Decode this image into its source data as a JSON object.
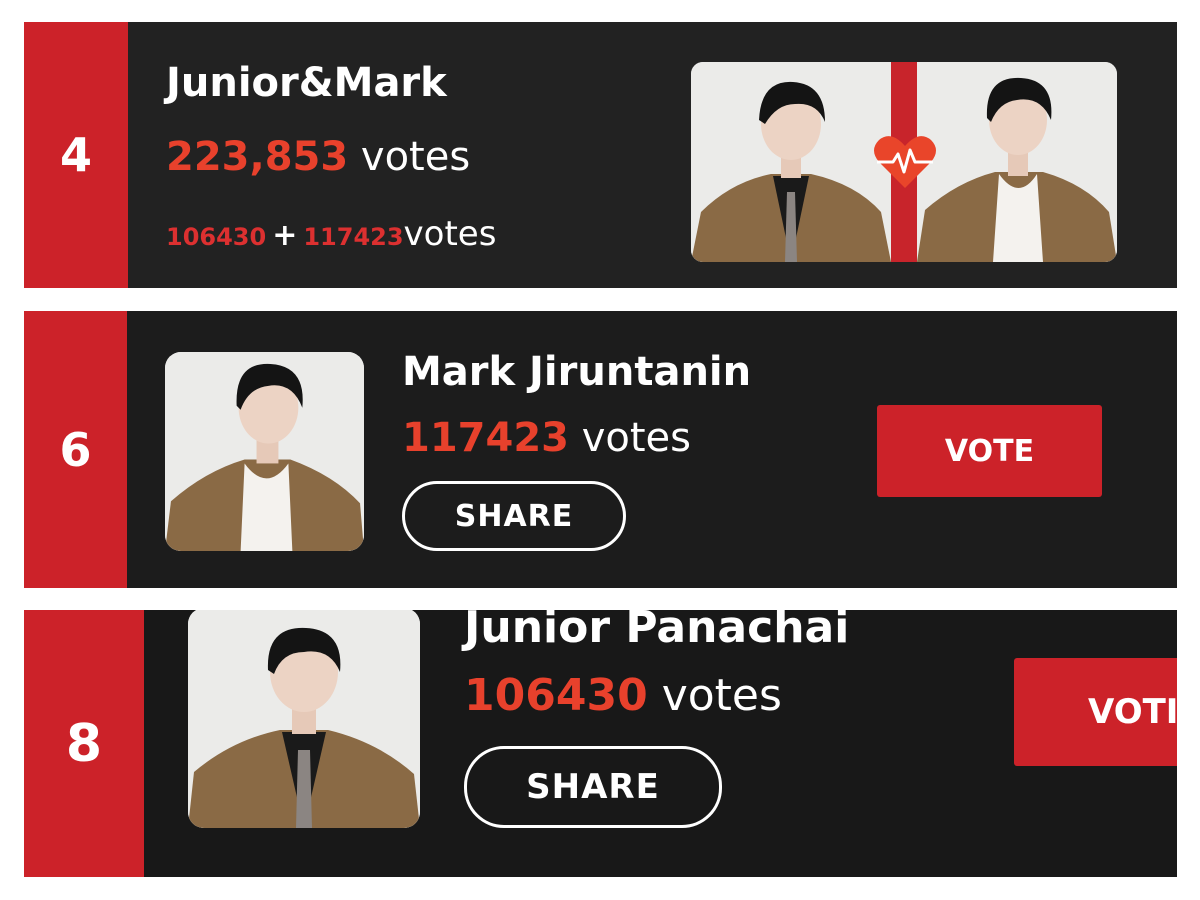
{
  "entries": [
    {
      "rank": "4",
      "name": "Junior&Mark",
      "votes_number": "223,853",
      "votes_word": "votes",
      "split_a": "106430",
      "split_plus": "+",
      "split_b": "117423",
      "split_word": "votes"
    },
    {
      "rank": "6",
      "name": "Mark Jiruntanin",
      "votes_number": "117423",
      "votes_word": "votes",
      "share_label": "SHARE",
      "vote_label": "VOTE"
    },
    {
      "rank": "8",
      "name": "Junior Panachai",
      "votes_number": "106430",
      "votes_word": "votes",
      "share_label": "SHARE",
      "vote_label": "VOTI"
    }
  ],
  "colors": {
    "accent_red": "#cc2229",
    "vote_number": "#e8412c",
    "card_bg": "#1d1d1d"
  },
  "icons": [
    "heart-pulse-icon"
  ]
}
